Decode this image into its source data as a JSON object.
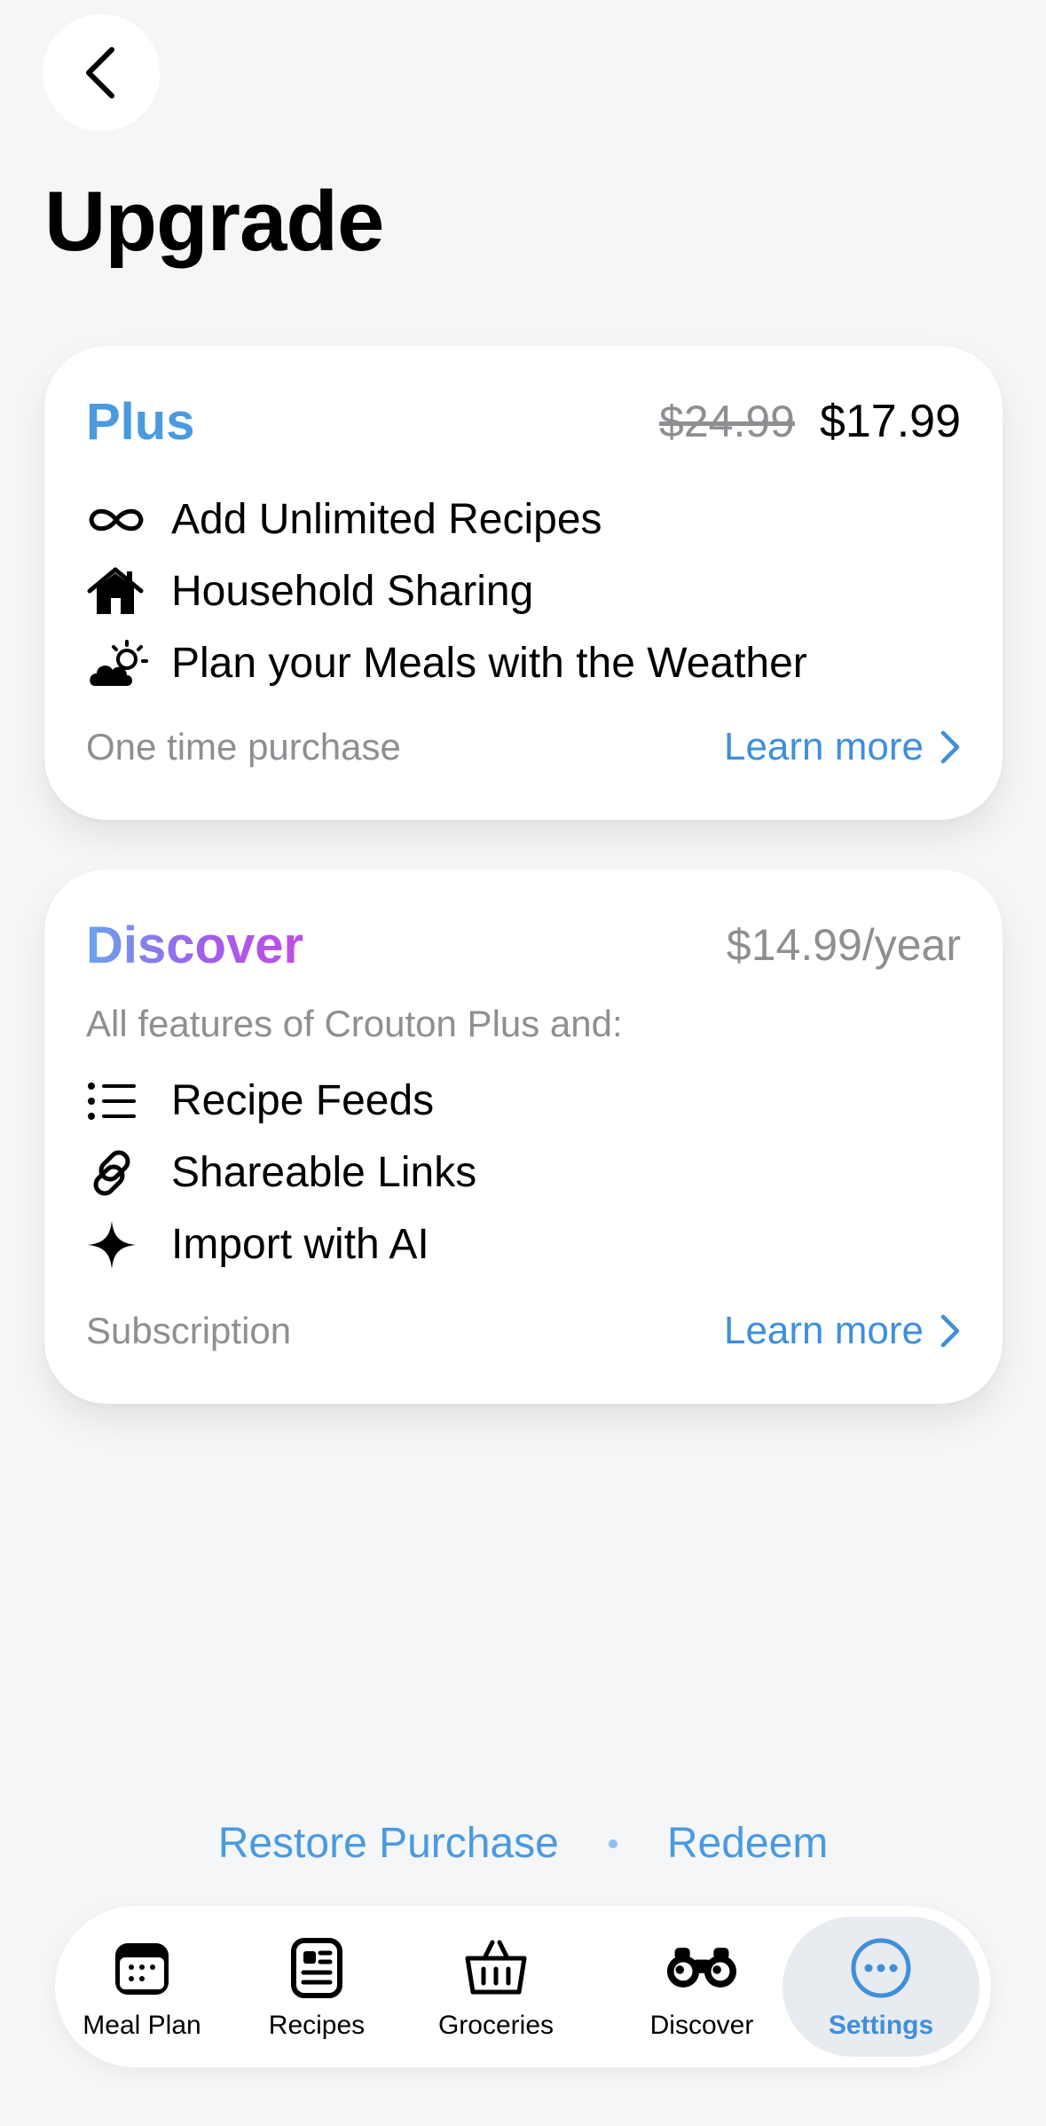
{
  "header": {
    "title": "Upgrade"
  },
  "plans": [
    {
      "name": "Plus",
      "old_price": "$24.99",
      "price": "$17.99",
      "features": [
        {
          "icon": "infinity-icon",
          "label": "Add Unlimited Recipes"
        },
        {
          "icon": "house-icon",
          "label": "Household Sharing"
        },
        {
          "icon": "cloud-sun-icon",
          "label": "Plan your Meals with the Weather"
        }
      ],
      "footnote": "One time purchase",
      "learn_more": "Learn more"
    },
    {
      "name": "Discover",
      "price": "$14.99/year",
      "subtitle": "All features of Crouton Plus and:",
      "features": [
        {
          "icon": "list-icon",
          "label": "Recipe Feeds"
        },
        {
          "icon": "link-icon",
          "label": "Shareable Links"
        },
        {
          "icon": "sparkle-icon",
          "label": "Import with AI"
        }
      ],
      "footnote": "Subscription",
      "learn_more": "Learn more"
    }
  ],
  "links": {
    "restore": "Restore Purchase",
    "redeem": "Redeem"
  },
  "tabbar": {
    "active": "Settings",
    "items": [
      {
        "label": "Meal Plan",
        "icon": "calendar-icon"
      },
      {
        "label": "Recipes",
        "icon": "recipe-book-icon"
      },
      {
        "label": "Groceries",
        "icon": "basket-icon"
      },
      {
        "label": "Discover",
        "icon": "binoculars-icon"
      },
      {
        "label": "Settings",
        "icon": "ellipsis-circle-icon"
      }
    ]
  },
  "colors": {
    "accent": "#4a9ae0",
    "background": "#f5f6f8",
    "secondary_text": "#8e8e93"
  }
}
